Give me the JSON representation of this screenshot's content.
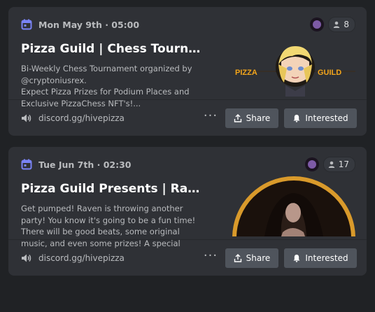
{
  "events": [
    {
      "date": "Mon May 9th · 05:00",
      "attendee_count": "8",
      "title": "Pizza Guild | Chess Tournam...",
      "description": "Bi-Weekly Chess Tournament organized by @cryptoniusrex.\nExpect Pizza Prizes for Podium Places and Exclusive PizzaChess NFT's!...",
      "banner": {
        "left_text": "PIZZA",
        "right_text": "GUILD"
      },
      "link": "discord.gg/hivepizza",
      "share_label": "Share",
      "interested_label": "Interested"
    },
    {
      "date": "Tue Jun 7th · 02:30",
      "attendee_count": "17",
      "title": "Pizza Guild Presents | Raven'...",
      "description": "Get pumped! Raven is throwing another party! You know it's going to be a fun time! There will be good beats, some original music, and even some prizes! A special guest will be joining us t...",
      "link": "discord.gg/hivepizza",
      "share_label": "Share",
      "interested_label": "Interested"
    }
  ],
  "colors": {
    "background": "#202225",
    "card": "#2f3136",
    "button": "#4f545c",
    "accent_calendar": "#7983f5",
    "banner_text": "#f2a51c"
  },
  "icons": [
    "calendar-icon",
    "person-icon",
    "mic-icon",
    "share-icon",
    "bell-icon",
    "more-icon"
  ]
}
